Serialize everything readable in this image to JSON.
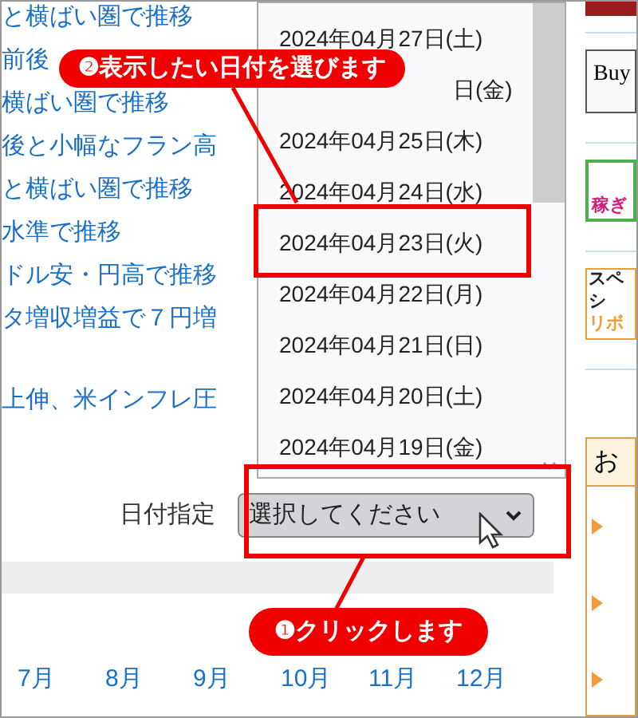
{
  "news_links": [
    {
      "text": "と横ばい圏で推移"
    },
    {
      "text": "前後"
    },
    {
      "text": "横ばい圏で推移"
    },
    {
      "text": "後と小幅なフラン高"
    },
    {
      "text": "と横ばい圏で推移"
    },
    {
      "text": "水準で推移"
    },
    {
      "text": "ドル安・円高で推移"
    },
    {
      "text": "タ増収増益で７円増"
    },
    {
      "text": "上伸、米インフレ圧"
    }
  ],
  "date_dropdown": {
    "options": [
      {
        "text": "2024年04月27日(土)"
      },
      {
        "text": "日(金)"
      },
      {
        "text": "2024年04月25日(木)"
      },
      {
        "text": "2024年04月24日(水)"
      },
      {
        "text": "2024年04月23日(火)"
      },
      {
        "text": "2024年04月22日(月)"
      },
      {
        "text": "2024年04月21日(日)"
      },
      {
        "text": "2024年04月20日(土)"
      },
      {
        "text": "2024年04月19日(金)"
      }
    ]
  },
  "date_filter": {
    "label": "日付指定",
    "placeholder": "選択してください"
  },
  "month_rows": [
    [
      "7月",
      "8月",
      "9月",
      "10月",
      "11月",
      "12月"
    ]
  ],
  "sidebar": {
    "banners": [
      "Buy",
      "稼ぎ",
      "スペシ",
      "リボ"
    ],
    "box_title": "お"
  },
  "callouts": [
    {
      "number": "❷",
      "text": "表示したい日付を選びます"
    },
    {
      "number": "❶",
      "text": "クリックします"
    }
  ]
}
